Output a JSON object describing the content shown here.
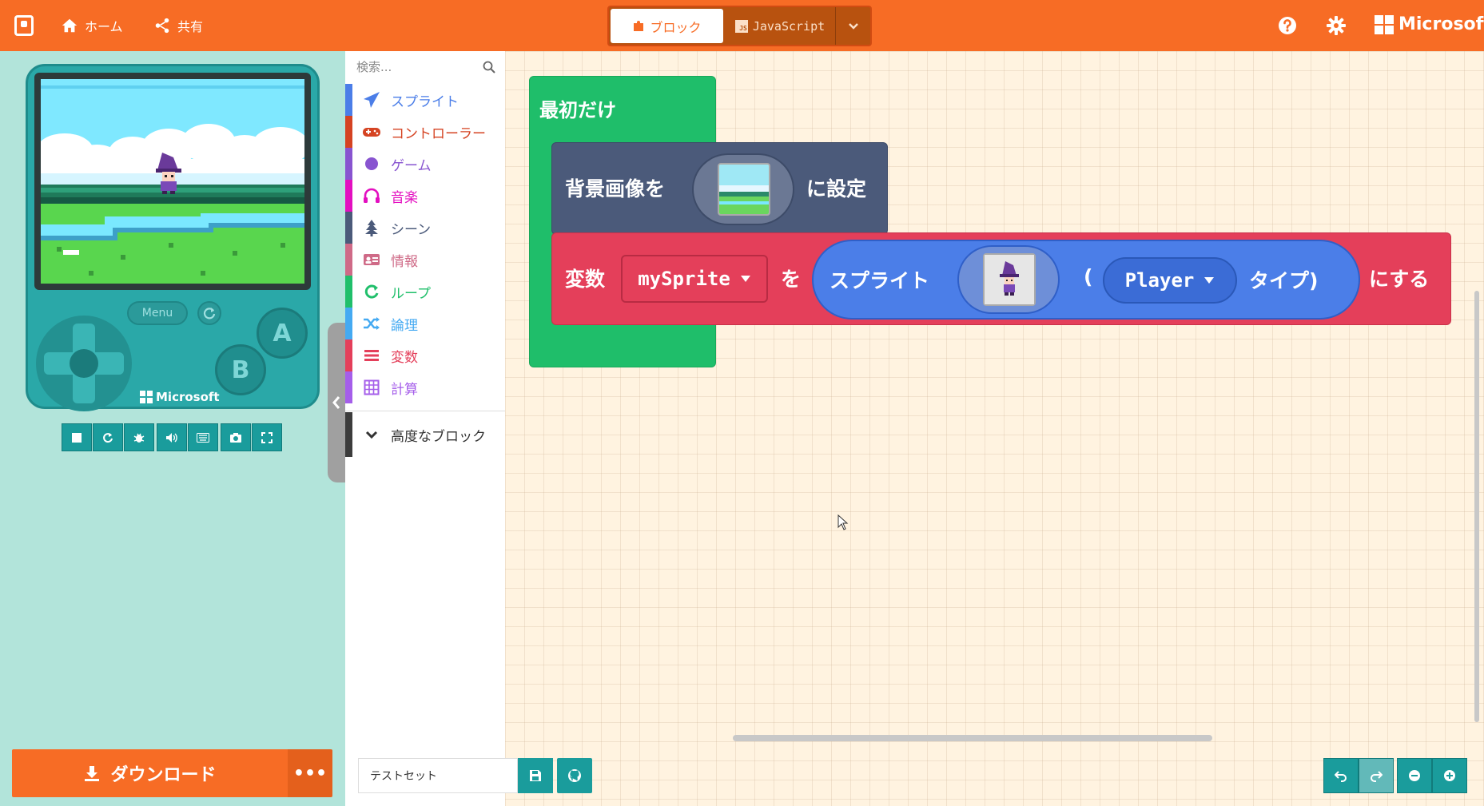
{
  "header": {
    "home_label": "ホーム",
    "share_label": "共有",
    "blocks_label": "ブロック",
    "js_badge": "JS",
    "javascript_label": "JavaScript",
    "brand": "Microsoft"
  },
  "simulator": {
    "menu_label": "Menu",
    "btn_a": "A",
    "btn_b": "B",
    "brand": "Microsoft",
    "download_label": "ダウンロード",
    "more_label": "•••"
  },
  "toolbox": {
    "search_placeholder": "検索...",
    "categories": [
      {
        "label": "スプライト",
        "color": "#4b7ee8",
        "icon": "paper-plane-icon"
      },
      {
        "label": "コントローラー",
        "color": "#d54322",
        "icon": "gamepad-icon"
      },
      {
        "label": "ゲーム",
        "color": "#8854d0",
        "icon": "circle-icon"
      },
      {
        "label": "音楽",
        "color": "#e30fc0",
        "icon": "headphones-icon"
      },
      {
        "label": "シーン",
        "color": "#4b5a7a",
        "icon": "tree-icon"
      },
      {
        "label": "情報",
        "color": "#cf6a87",
        "icon": "id-card-icon"
      },
      {
        "label": "ループ",
        "color": "#20bf6b",
        "icon": "loop-icon"
      },
      {
        "label": "論理",
        "color": "#45aaf2",
        "icon": "shuffle-icon"
      },
      {
        "label": "変数",
        "color": "#e43f5a",
        "icon": "list-icon"
      },
      {
        "label": "計算",
        "color": "#a55eea",
        "icon": "calculator-icon"
      }
    ],
    "advanced_label": "高度なブロック"
  },
  "workspace": {
    "on_start_label": "最初だけ",
    "set_background_prefix": "背景画像を",
    "set_background_suffix": "に設定",
    "set_var_prefix": "変数",
    "var_name": "mySprite",
    "set_var_wo": "を",
    "sprite_label": "スプライト",
    "sprite_paren_open": "(",
    "kind_value": "Player",
    "sprite_type_suffix": "タイプ)",
    "set_var_suffix": "にする"
  },
  "footer": {
    "project_name": "テストセット"
  },
  "colors": {
    "header": "#f76c25",
    "on_start": "#1fbe6a",
    "scene": "#4b5a7a",
    "variables": "#e43f5a",
    "sprites": "#4b7ee8",
    "teal": "#1a9c9c"
  }
}
